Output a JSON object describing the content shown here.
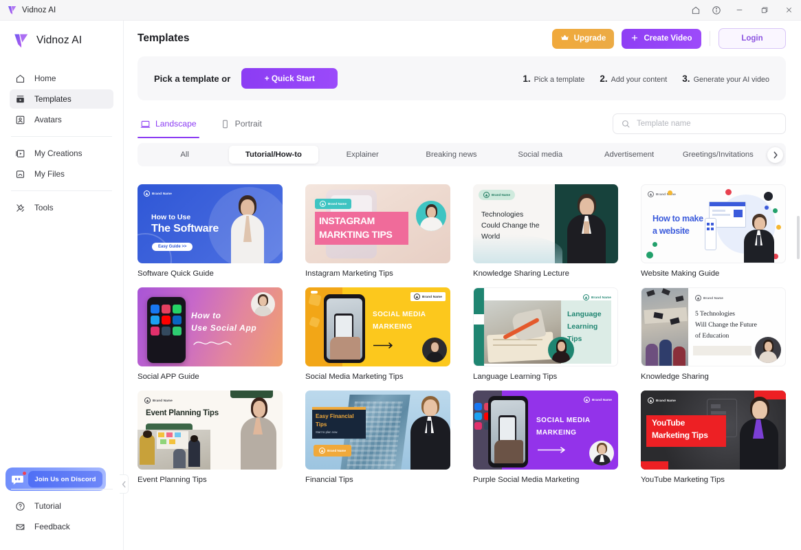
{
  "window": {
    "app_name": "Vidnoz AI",
    "controls": [
      {
        "name": "home-icon",
        "label": "Home"
      },
      {
        "name": "info-icon",
        "label": "Info"
      },
      {
        "name": "minimize-icon",
        "label": "Minimize"
      },
      {
        "name": "maximize-icon",
        "label": "Maximize"
      },
      {
        "name": "close-icon",
        "label": "Close"
      }
    ]
  },
  "sidebar": {
    "brand": "Vidnoz AI",
    "groups": [
      {
        "items": [
          {
            "label": "Home",
            "icon": "home-icon",
            "active": false
          },
          {
            "label": "Templates",
            "icon": "templates-icon",
            "active": true
          },
          {
            "label": "Avatars",
            "icon": "avatars-icon",
            "active": false
          }
        ]
      },
      {
        "items": [
          {
            "label": "My Creations",
            "icon": "my-creations-icon",
            "active": false
          },
          {
            "label": "My Files",
            "icon": "my-files-icon",
            "active": false
          }
        ]
      },
      {
        "items": [
          {
            "label": "Tools",
            "icon": "tools-icon",
            "active": false
          }
        ]
      }
    ],
    "discord": {
      "label": "Join Us on Discord",
      "icon": "discord-icon",
      "has_notification": true
    },
    "bottom": [
      {
        "label": "Tutorial",
        "icon": "question-circle-icon"
      },
      {
        "label": "Feedback",
        "icon": "envelope-icon"
      }
    ]
  },
  "header": {
    "title": "Templates",
    "upgrade_label": "Upgrade",
    "create_label": "Create Video",
    "login_label": "Login"
  },
  "banner": {
    "pick_label": "Pick a template or",
    "quick_start_label": "+ Quick Start",
    "steps": [
      {
        "num": "1.",
        "text": "Pick a template"
      },
      {
        "num": "2.",
        "text": "Add your content"
      },
      {
        "num": "3.",
        "text": "Generate your AI video"
      }
    ]
  },
  "orientation": {
    "tabs": [
      {
        "label": "Landscape",
        "icon": "landscape-icon",
        "active": true
      },
      {
        "label": "Portrait",
        "icon": "portrait-icon",
        "active": false
      }
    ]
  },
  "search": {
    "placeholder": "Template name",
    "value": "",
    "icon": "search-icon"
  },
  "categories": {
    "items": [
      {
        "label": "All",
        "active": false
      },
      {
        "label": "Tutorial/How-to",
        "active": true
      },
      {
        "label": "Explainer",
        "active": false
      },
      {
        "label": "Breaking news",
        "active": false
      },
      {
        "label": "Social media",
        "active": false
      },
      {
        "label": "Advertisement",
        "active": false
      },
      {
        "label": "Greetings/Invitations",
        "active": false
      }
    ],
    "next_icon": "chevron-right-icon"
  },
  "templates": [
    {
      "title": "Software Quick Guide",
      "art": "software",
      "brand": "Brand Name",
      "headline1": "How to Use",
      "headline2": "The Software",
      "cta": "Easy Guide >>"
    },
    {
      "title": "Instagram Marketing Tips",
      "art": "instagram",
      "brand": "Brand Name",
      "headline1": "INSTAGRAM",
      "headline2": "MARKTING TIPS"
    },
    {
      "title": "Knowledge Sharing Lecture",
      "art": "knowledge",
      "brand": "Brand Name",
      "headline1": "Technologies",
      "headline2": "Could Change the",
      "headline3": "World"
    },
    {
      "title": "Website Making Guide",
      "art": "website",
      "brand": "Brand Name",
      "headline1": "How to make",
      "headline2": "a website"
    },
    {
      "title": "Social APP Guide",
      "art": "socialapp",
      "headline1": "How to",
      "headline2": "Use Social App"
    },
    {
      "title": "Social Media Marketing Tips",
      "art": "socialmedia",
      "brand": "Brand Name",
      "headline1": "SOCIAL MEDIA",
      "headline2": "MARKEING"
    },
    {
      "title": "Language Learning Tips",
      "art": "language",
      "brand": "Brand Name",
      "headline1": "Language",
      "headline2": "Learning",
      "headline3": "Tips"
    },
    {
      "title": "Knowledge Sharing",
      "art": "knowledge2",
      "brand": "Brand Name",
      "headline1": "5 Technologies",
      "headline2": "Will Change the Future",
      "headline3": "of Education"
    },
    {
      "title": "Event Planning Tips",
      "art": "event",
      "brand": "Brand Name",
      "headline1": "Event Planning Tips"
    },
    {
      "title": "Financial Tips",
      "art": "financial",
      "brand": "Brand Name",
      "headline1": "Easy Financial",
      "headline2": "Tips",
      "sub": "Start to plan now."
    },
    {
      "title": "Purple Social Media Marketing",
      "art": "purple",
      "brand": "Brand Name",
      "headline1": "SOCIAL MEDIA",
      "headline2": "MARKEING"
    },
    {
      "title": "YouTube Marketing Tips",
      "art": "youtube",
      "brand": "Brand Name",
      "headline1": "YouTube",
      "headline2": "Marketing Tips"
    }
  ],
  "colors": {
    "accent_purple": "#8b3cf3",
    "upgrade_orange": "#f0a93b",
    "login_purple": "#8b52e0",
    "discord_blue": "#5b74f7"
  }
}
